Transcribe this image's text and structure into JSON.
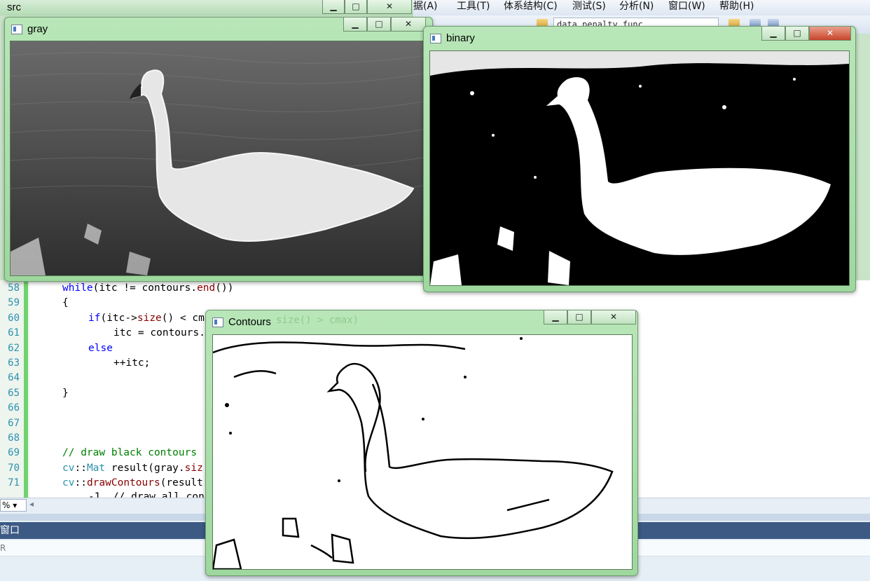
{
  "ide": {
    "menu": [
      "据(A)",
      "工具(T)",
      "体系结构(C)",
      "测试(S)",
      "分析(N)",
      "窗口(W)",
      "帮助(H)"
    ],
    "combo_value": "data_penalty_func",
    "zoom": "%",
    "output_title": "窗口",
    "output_sub": "R"
  },
  "code": {
    "line_numbers": [
      "58",
      "59",
      "60",
      "61",
      "62",
      "63",
      "64",
      "65",
      "66",
      "67",
      "68",
      "69",
      "70",
      "71"
    ],
    "lines": [
      {
        "segs": [
          [
            "kw",
            "while"
          ],
          [
            "",
            "(itc != contours."
          ],
          [
            "fn",
            "end"
          ],
          [
            "",
            "())"
          ]
        ]
      },
      {
        "segs": [
          [
            "",
            "{"
          ]
        ]
      },
      {
        "segs": [
          [
            "kw",
            "if"
          ],
          [
            "",
            "(itc->"
          ],
          [
            "fn",
            "size"
          ],
          [
            "",
            "() < cm"
          ]
        ]
      },
      {
        "segs": [
          [
            "",
            "itc = contours."
          ]
        ]
      },
      {
        "segs": [
          [
            "kw",
            "else"
          ]
        ]
      },
      {
        "segs": [
          [
            "",
            "++itc;"
          ]
        ]
      },
      {
        "segs": [
          [
            "",
            ""
          ]
        ]
      },
      {
        "segs": [
          [
            "",
            "}"
          ]
        ]
      },
      {
        "segs": [
          [
            "",
            ""
          ]
        ]
      },
      {
        "segs": [
          [
            "",
            ""
          ]
        ]
      },
      {
        "segs": [
          [
            "",
            ""
          ]
        ]
      },
      {
        "segs": [
          [
            "cm",
            "// draw black contours "
          ]
        ]
      },
      {
        "segs": [
          [
            "ty",
            "cv"
          ],
          [
            "",
            "::"
          ],
          [
            "ty",
            "Mat"
          ],
          [
            "",
            " result(gray."
          ],
          [
            "fn",
            "siz"
          ]
        ]
      },
      {
        "segs": [
          [
            "ty",
            "cv"
          ],
          [
            "",
            "::"
          ],
          [
            "fn",
            "drawContours"
          ],
          [
            "",
            "(result"
          ]
        ]
      }
    ],
    "partial_line": "-1, // draw all con"
  },
  "windows": {
    "src": {
      "title": "src"
    },
    "gray": {
      "title": "gray"
    },
    "binary": {
      "title": "binary"
    },
    "contours": {
      "title": "Contours",
      "ghost_text": "size() > cmax)"
    }
  },
  "icons": [
    "app-icon",
    "minimize-icon",
    "maximize-icon",
    "close-icon"
  ]
}
